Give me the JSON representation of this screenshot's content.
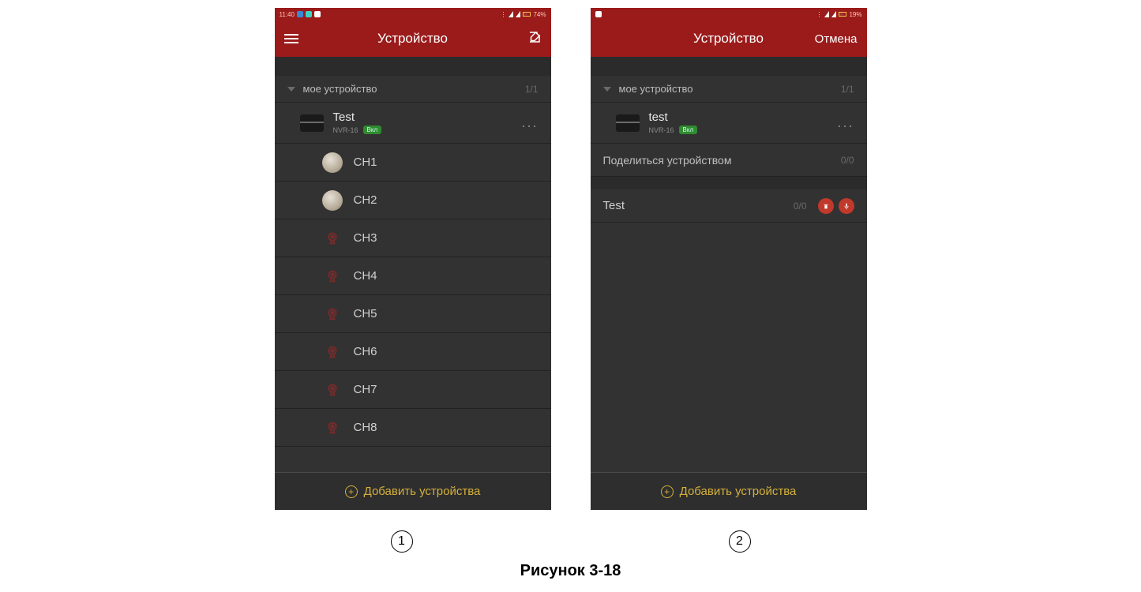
{
  "caption": "Рисунок 3-18",
  "markers": [
    "1",
    "2"
  ],
  "add_label": "Добавить устройства",
  "screen1": {
    "statusbar_time": "11:40",
    "statusbar_batt": "74%",
    "appbar_title": "Устройство",
    "section_label": "мое устройство",
    "section_count": "1/1",
    "device": {
      "name": "Test",
      "model": "NVR-16",
      "badge": "Вкл"
    },
    "channels": [
      {
        "label": "CH1",
        "online": true
      },
      {
        "label": "CH2",
        "online": true
      },
      {
        "label": "CH3",
        "online": false
      },
      {
        "label": "CH4",
        "online": false
      },
      {
        "label": "CH5",
        "online": false
      },
      {
        "label": "CH6",
        "online": false
      },
      {
        "label": "CH7",
        "online": false
      },
      {
        "label": "CH8",
        "online": false
      }
    ]
  },
  "screen2": {
    "statusbar_batt": "19%",
    "appbar_title": "Устройство",
    "cancel_label": "Отмена",
    "section_label": "мое устройство",
    "section_count": "1/1",
    "device": {
      "name": "test",
      "model": "NVR-16",
      "badge": "Вкл"
    },
    "share_section_label": "Поделиться устройством",
    "share_section_count": "0/0",
    "share_item": {
      "name": "Test",
      "count": "0/0"
    }
  }
}
